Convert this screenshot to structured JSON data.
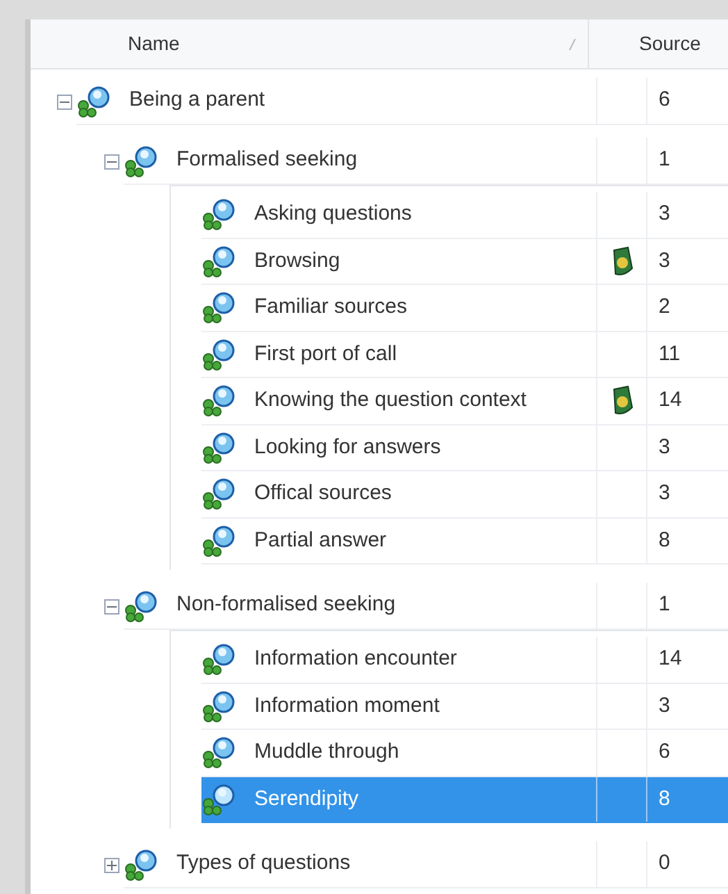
{
  "columns": [
    {
      "label": "Name",
      "sorted": true
    },
    {
      "label": "Source"
    }
  ],
  "nodes": [
    {
      "name": "Being a parent",
      "sources": "6",
      "memo": false,
      "selected": false,
      "expanded": true,
      "children": [
        {
          "name": "Formalised seeking",
          "sources": "1",
          "memo": false,
          "selected": false,
          "expanded": true,
          "children": [
            {
              "name": "Asking questions",
              "sources": "3",
              "memo": false,
              "selected": false
            },
            {
              "name": "Browsing",
              "sources": "3",
              "memo": true,
              "selected": false
            },
            {
              "name": "Familiar sources",
              "sources": "2",
              "memo": false,
              "selected": false
            },
            {
              "name": "First port of call",
              "sources": "11",
              "memo": false,
              "selected": false
            },
            {
              "name": "Knowing the question context",
              "sources": "14",
              "memo": true,
              "selected": false
            },
            {
              "name": "Looking for answers",
              "sources": "3",
              "memo": false,
              "selected": false
            },
            {
              "name": "Offical sources",
              "sources": "3",
              "memo": false,
              "selected": false
            },
            {
              "name": "Partial answer",
              "sources": "8",
              "memo": false,
              "selected": false
            }
          ]
        },
        {
          "name": "Non-formalised seeking",
          "sources": "1",
          "memo": false,
          "selected": false,
          "expanded": true,
          "children": [
            {
              "name": "Information encounter",
              "sources": "14",
              "memo": false,
              "selected": false
            },
            {
              "name": "Information moment",
              "sources": "3",
              "memo": false,
              "selected": false
            },
            {
              "name": "Muddle through",
              "sources": "6",
              "memo": false,
              "selected": false
            },
            {
              "name": "Serendipity",
              "sources": "8",
              "memo": false,
              "selected": true
            }
          ]
        },
        {
          "name": "Types of questions",
          "sources": "0",
          "memo": false,
          "selected": false,
          "expanded": false
        }
      ]
    }
  ]
}
